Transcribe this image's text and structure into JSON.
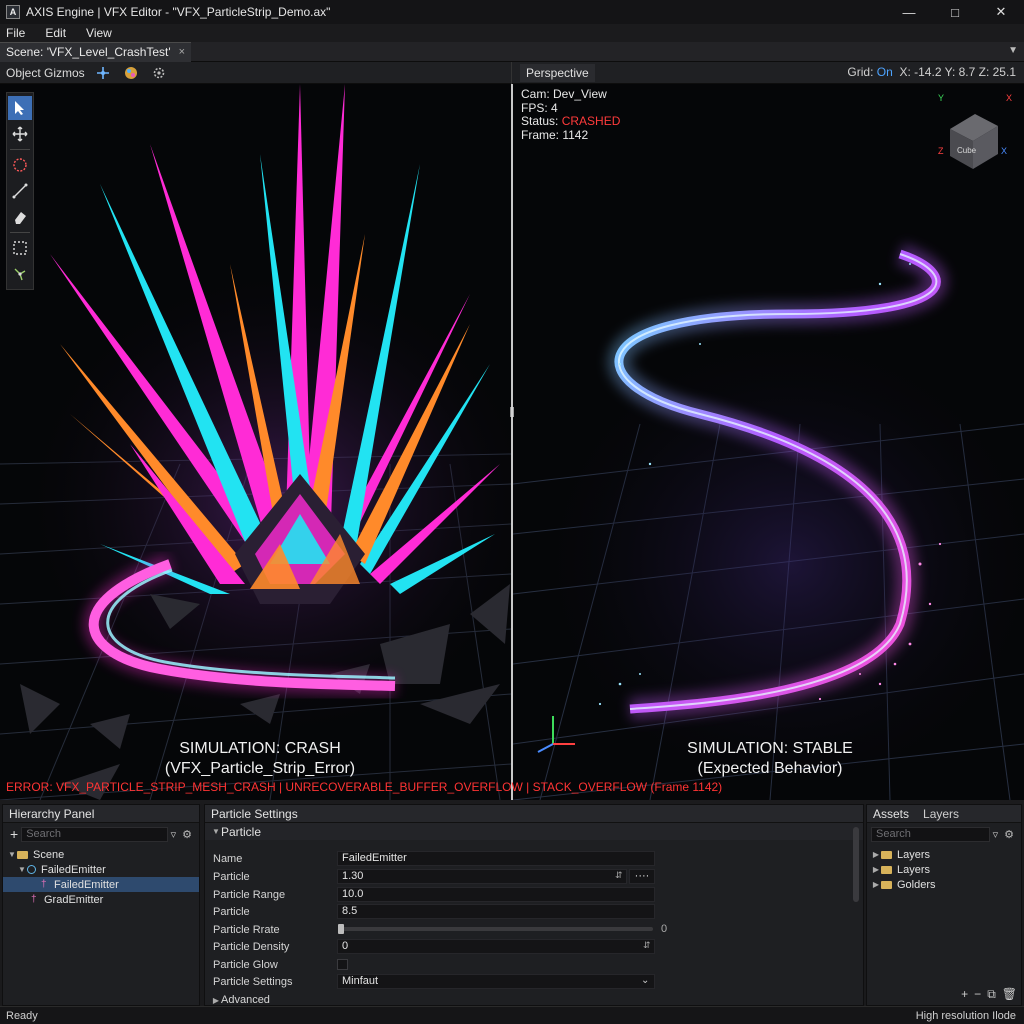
{
  "window": {
    "title": "AXIS Engine | VFX Editor - \"VFX_ParticleStrip_Demo.ax\"",
    "icon_letter": "A"
  },
  "menu": [
    "File",
    "Edit",
    "View"
  ],
  "scene_tab": {
    "label": "Scene: 'VFX_Level_CrashTest'",
    "close": "×"
  },
  "toolbar": {
    "object_gizmos": "Object Gizmos",
    "perspective": "Perspective",
    "grid_label": "Grid:",
    "grid_value": "On",
    "coords": "X: -14.2  Y: 8.7  Z: 25.1"
  },
  "viewport": {
    "cam": "Cam: Dev_View",
    "fps": "FPS: 4",
    "status_label": "Status:",
    "status_value": "CRASHED",
    "frame": "Frame: 1142",
    "crash_title": "SIMULATION: CRASH",
    "crash_sub": "(VFX_Particle_Strip_Error)",
    "stable_title": "SIMULATION: STABLE",
    "stable_sub": "(Expected Behavior)",
    "error_text": "ERROR: VFX_PARTICLE_STRIP_MESH_CRASH | UNRECOVERABLE_BUFFER_OVERFLOW | STACK_OVERFLOW (Frame 1142)",
    "gizmo_cube_label": "Cube",
    "axes": {
      "y": "Y",
      "x": "X",
      "z": "Z"
    },
    "colors": {
      "magenta": "#ff2bd6",
      "cyan": "#22e3f2",
      "orange": "#ff8a2a",
      "crash_red": "#ff3b3b"
    }
  },
  "hierarchy": {
    "title": "Hierarchy Panel",
    "search_placeholder": "Search",
    "items": [
      {
        "label": "Scene"
      },
      {
        "label": "FailedEmitter"
      },
      {
        "label": "FailedEmitter"
      },
      {
        "label": "GradEmitter"
      }
    ]
  },
  "particle_settings": {
    "title": "Particle Settings",
    "section": "Particle",
    "rows": [
      {
        "label": "Name",
        "value": "FailedEmitter"
      },
      {
        "label": "Particle",
        "value": "1.30"
      },
      {
        "label": "Particle Range",
        "value": "10.0"
      },
      {
        "label": "Particle",
        "value": "8.5"
      },
      {
        "label": "Particle Rrate",
        "value": "0"
      },
      {
        "label": "Particle Density",
        "value": "0"
      },
      {
        "label": "Particle Glow",
        "value": ""
      },
      {
        "label": "Particle Settings",
        "value": "Minfaut"
      }
    ],
    "advanced": "Advanced",
    "more_button": "····"
  },
  "assets": {
    "tab_assets": "Assets",
    "tab_layers": "Layers",
    "search_placeholder": "Search",
    "items": [
      "Layers",
      "Layers",
      "Golders"
    ]
  },
  "status": {
    "left": "Ready",
    "right": "High resolution Ilode"
  }
}
